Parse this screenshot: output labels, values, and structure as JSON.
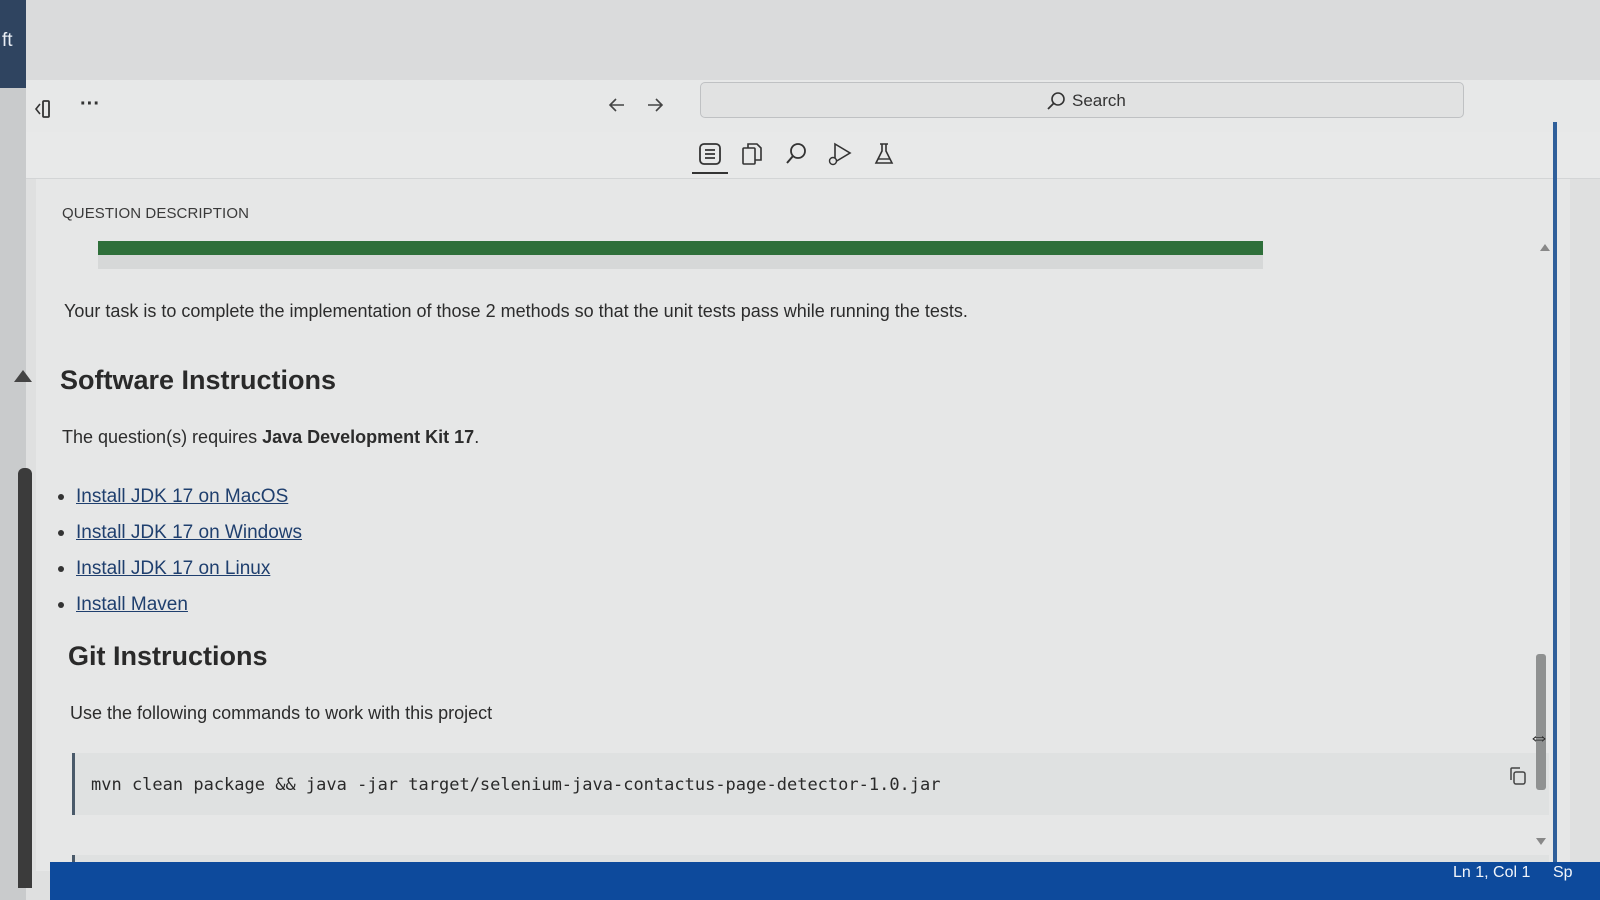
{
  "window": {
    "edge_label": "ft"
  },
  "nav": {
    "search_placeholder": "Search"
  },
  "toolbar": {
    "tools": [
      "description-icon",
      "copy-files-icon",
      "search-icon",
      "run-debug-icon",
      "test-flask-icon"
    ],
    "active": "description-icon"
  },
  "content": {
    "section_label": "QUESTION DESCRIPTION",
    "progress_percent": 100,
    "task_text": "Your task is to complete the implementation of those 2 methods so that the unit tests pass while running the tests.",
    "software": {
      "heading": "Software Instructions",
      "intro_prefix": "The question(s) requires ",
      "intro_bold": "Java Development Kit 17",
      "intro_suffix": ".",
      "links": [
        "Install JDK 17 on MacOS",
        "Install JDK 17 on Windows",
        "Install JDK 17 on Linux",
        "Install Maven"
      ]
    },
    "git": {
      "heading": "Git Instructions",
      "intro": "Use the following commands to work with this project",
      "command": "mvn clean package && java -jar target/selenium-java-contactus-page-detector-1.0.jar"
    }
  },
  "statusbar": {
    "cursor": "Ln 1, Col 1",
    "extra": "Sp"
  },
  "colors": {
    "progress": "#2e6f3a",
    "statusbar": "#0d4a9c",
    "link": "#1f3f6e"
  }
}
